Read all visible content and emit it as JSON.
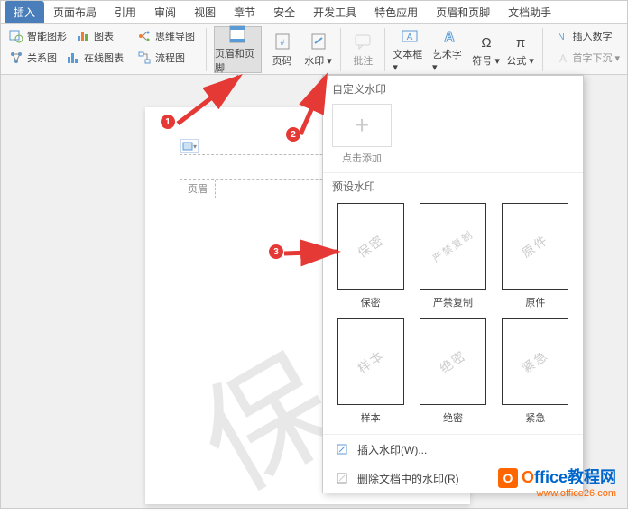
{
  "tabs": [
    "插入",
    "页面布局",
    "引用",
    "审阅",
    "视图",
    "章节",
    "安全",
    "开发工具",
    "特色应用",
    "页眉和页脚",
    "文档助手"
  ],
  "active_tab_index": 0,
  "ribbon": {
    "col1": {
      "a": "图",
      "b": "智能图形",
      "c": "图表"
    },
    "col2": {
      "a": "图",
      "b": "关系图",
      "c": "在线图表"
    },
    "col3": {
      "a": "思维导图",
      "b": "流程图"
    },
    "header_footer": "页眉和页脚",
    "page_number": "页码",
    "watermark": "水印",
    "annotation": "批注",
    "textbox": "文本框",
    "wordart": "艺术字",
    "symbol": "符号",
    "formula": "公式",
    "insert_number": "插入数字",
    "dropcap": "首字下沉"
  },
  "doc": {
    "header_label": "页眉"
  },
  "dropdown": {
    "custom_title": "自定义水印",
    "add_label": "点击添加",
    "preset_title": "预设水印",
    "presets": [
      {
        "text": "保密",
        "label": "保密"
      },
      {
        "text": "严禁复制",
        "label": "严禁复制"
      },
      {
        "text": "原件",
        "label": "原件"
      },
      {
        "text": "样本",
        "label": "样本"
      },
      {
        "text": "绝密",
        "label": "绝密"
      },
      {
        "text": "紧急",
        "label": "紧急"
      }
    ],
    "insert": "插入水印(W)...",
    "remove": "删除文档中的水印(R)"
  },
  "badges": {
    "b1": "1",
    "b2": "2",
    "b3": "3"
  },
  "branding": {
    "title_prefix": "O",
    "title_rest": "ffice教程网",
    "url": "www.office26.com",
    "icon": "O"
  }
}
